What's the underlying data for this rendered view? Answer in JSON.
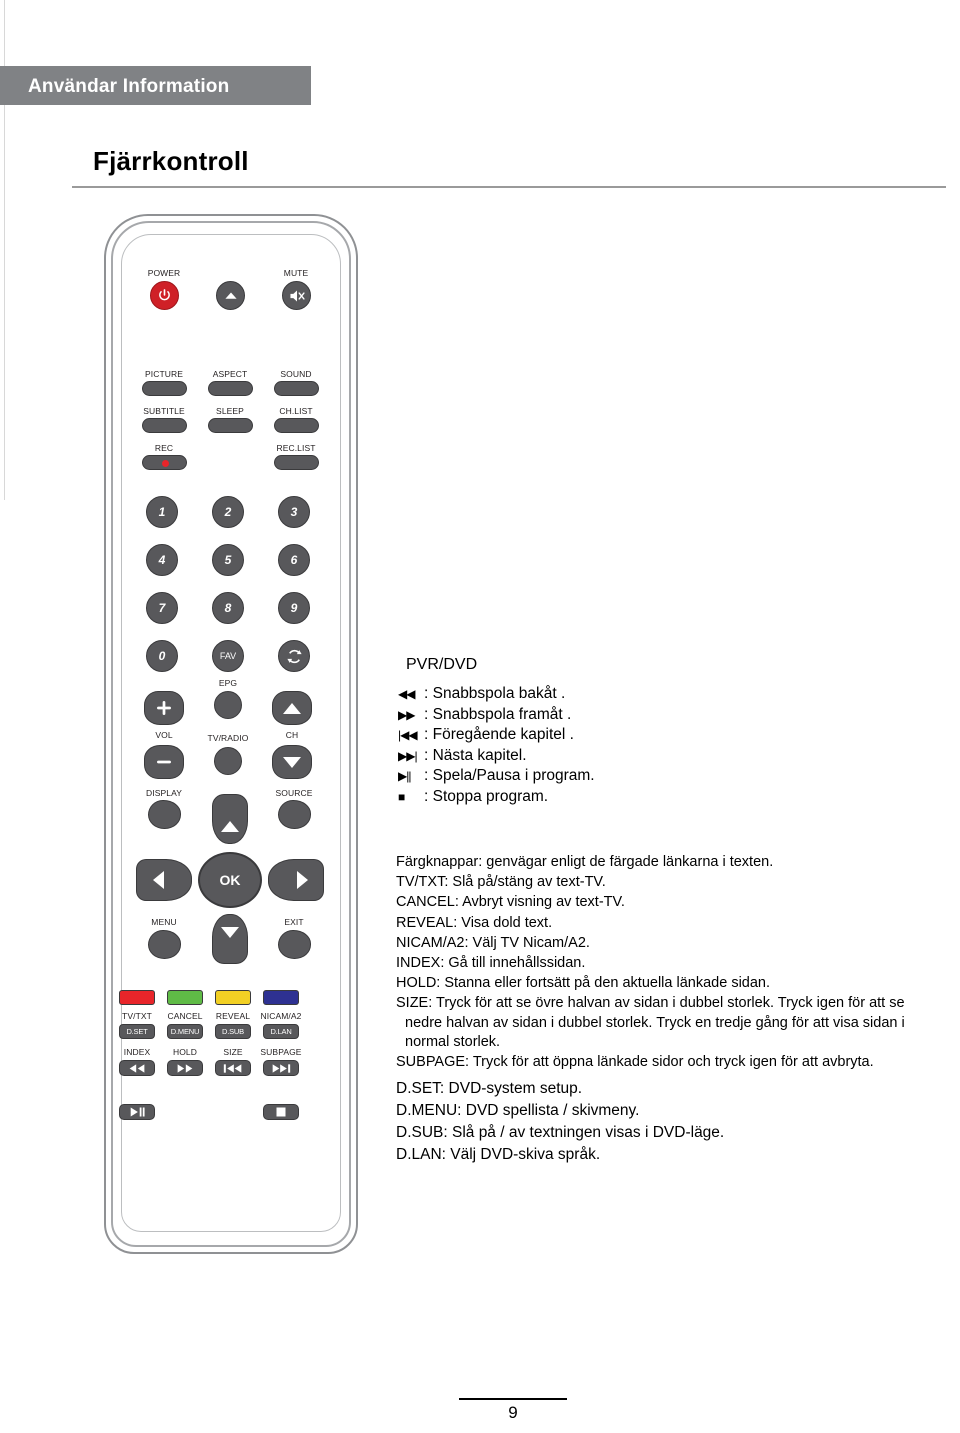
{
  "header": {
    "section_label": "Användar Information",
    "title": "Fjärrkontroll"
  },
  "footer": {
    "page_number": "9"
  },
  "remote": {
    "labels": {
      "power": "POWER",
      "mute": "MUTE",
      "picture": "PICTURE",
      "aspect": "ASPECT",
      "sound": "SOUND",
      "subtitle": "SUBTITLE",
      "sleep": "SLEEP",
      "chlist": "CH.LIST",
      "rec": "REC",
      "reclist": "REC.LIST",
      "fav": "FAV",
      "epg": "EPG",
      "vol": "VOL",
      "tvradio": "TV/RADIO",
      "ch": "CH",
      "display": "DISPLAY",
      "source": "SOURCE",
      "menu": "MENU",
      "ok": "OK",
      "exit": "EXIT",
      "tvtxt": "TV/TXT",
      "cancel": "CANCEL",
      "reveal": "REVEAL",
      "nicam": "NICAM/A2",
      "dset": "D.SET",
      "dmenu": "D.MENU",
      "dsub": "D.SUB",
      "dlan": "D.LAN",
      "index": "INDEX",
      "hold": "HOLD",
      "size": "SIZE",
      "subpage": "SUBPAGE"
    },
    "digits": [
      "1",
      "2",
      "3",
      "4",
      "5",
      "6",
      "7",
      "8",
      "9",
      "0"
    ],
    "colors": {
      "red": "#E8252A",
      "green": "#5FBB46",
      "yellow": "#F2D024",
      "blue": "#2E3192",
      "power_red": "#CF2027",
      "button_grey": "#58585B",
      "shell_grey": "#8F9194"
    },
    "glyphs": {
      "eject": "▲",
      "mute": "mute-speaker",
      "recall": "↻",
      "vol_up": "+",
      "vol_down": "−",
      "rewind": "◀◀",
      "forward": "▶▶",
      "previous": "|◀◀",
      "next": "▶▶|",
      "playpause": "▶||",
      "stop": "■"
    }
  },
  "pvr": {
    "heading": "PVR/DVD",
    "rows": [
      {
        "icon": "◀◀",
        "text": ": Snabbspola bakåt ."
      },
      {
        "icon": "▶▶",
        "text": ": Snabbspola framåt ."
      },
      {
        "icon": "|◀◀",
        "text": ": Föregående kapitel ."
      },
      {
        "icon": "▶▶|",
        "text": ": Nästa kapitel."
      },
      {
        "icon": "▶||",
        "text": ": Spela/Pausa i program."
      },
      {
        "icon": "■",
        "text": ": Stoppa program."
      }
    ]
  },
  "description": {
    "lines": [
      "Färgknappar: genvägar enligt de färgade länkarna i texten.",
      "TV/TXT: Slå på/stäng av text-TV.",
      "CANCEL: Avbryt visning av text-TV.",
      "REVEAL: Visa dold text.",
      "NICAM/A2: Välj TV Nicam/A2.",
      "INDEX: Gå till innehållssidan.",
      "HOLD: Stanna eller fortsätt på den aktuella länkade sidan.",
      "SIZE: Tryck för att se övre halvan av sidan i dubbel storlek. Tryck igen för att se nedre halvan av sidan i dubbel storlek. Tryck en tredje gång för att visa sidan i normal storlek.",
      "SUBPAGE: Tryck för att öppna länkade sidor och tryck igen för att avbryta."
    ],
    "dvd_lines": [
      "D.SET:  DVD-system setup.",
      "D.MENU:  DVD spellista / skivmeny.",
      "D.SUB:  Slå på / av textningen visas i DVD-läge.",
      "D.LAN:  Välj DVD-skiva språk."
    ]
  }
}
